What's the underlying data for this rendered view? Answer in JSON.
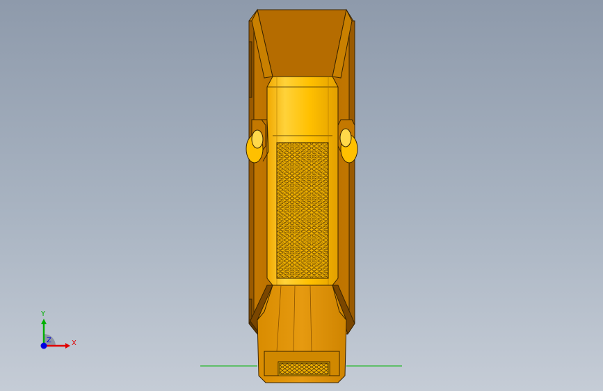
{
  "viewport": {
    "background_top": "#8e9aab",
    "background_bottom": "#c5ccd6"
  },
  "model": {
    "body_color": "#b36b00",
    "body_highlight": "#e69a00",
    "insert_color": "#ffc000",
    "insert_dark": "#e6a800",
    "edge_color": "#3a2400",
    "mesh_color": "#6b4a10",
    "ground_line_color": "#00b400"
  },
  "triad": {
    "x_label": "X",
    "y_label": "Y",
    "z_label": "Z",
    "x_color": "#e00000",
    "y_color": "#00b000",
    "z_color": "#0000e0"
  }
}
